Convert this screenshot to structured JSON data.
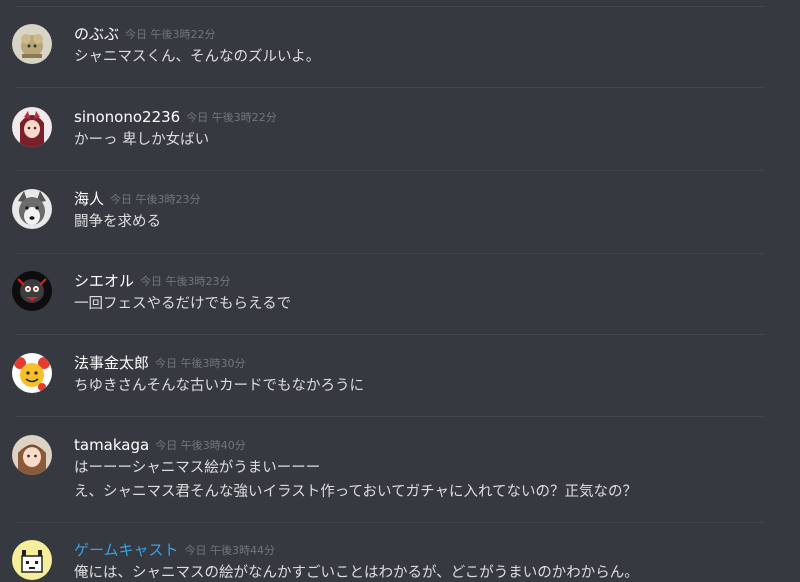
{
  "messages": [
    {
      "author": "のぶぶ",
      "timestamp": "今日 午後3時22分",
      "lines": [
        "シャニマスくん、そんなのズルいよ。"
      ],
      "avatar_icon": "sheep-avatar-icon",
      "author_color": "#ffffff"
    },
    {
      "author": "sinonono2236",
      "timestamp": "今日 午後3時22分",
      "lines": [
        "かーっ 卑しか女ばい"
      ],
      "avatar_icon": "anime-girl-avatar-icon",
      "author_color": "#ffffff"
    },
    {
      "author": "海人",
      "timestamp": "今日 午後3時23分",
      "lines": [
        "闘争を求める"
      ],
      "avatar_icon": "husky-avatar-icon",
      "author_color": "#ffffff"
    },
    {
      "author": "シエオル",
      "timestamp": "今日 午後3時23分",
      "lines": [
        "一回フェスやるだけでもらえるで"
      ],
      "avatar_icon": "dark-character-avatar-icon",
      "author_color": "#ffffff"
    },
    {
      "author": "法事金太郎",
      "timestamp": "今日 午後3時30分",
      "lines": [
        "ちゆきさんそんな古いカードでもなかろうに"
      ],
      "avatar_icon": "cartoon-face-avatar-icon",
      "author_color": "#ffffff"
    },
    {
      "author": "tamakaga",
      "timestamp": "今日 午後3時40分",
      "lines": [
        "はーーーシャニマス絵がうまいーーー",
        "え、シャニマス君そんな強いイラスト作っておいてガチャに入れてないの？正気なの？"
      ],
      "avatar_icon": "brown-hair-girl-avatar-icon",
      "author_color": "#ffffff"
    },
    {
      "author": "ゲームキャスト",
      "timestamp": "今日 午後3時44分",
      "lines": [
        "俺には、シャニマスの絵がなんかすごいことはわかるが、どこがうまいのかわからん。"
      ],
      "avatar_icon": "pixel-cat-avatar-icon",
      "author_color": "#3aa0e9"
    }
  ]
}
